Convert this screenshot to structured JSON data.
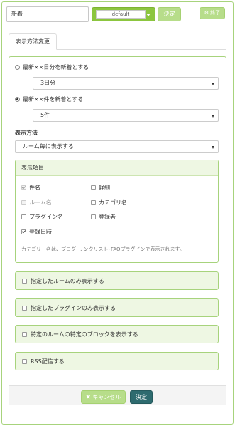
{
  "header": {
    "title_value": "新着",
    "style_select_value": "default",
    "decide_label": "決定",
    "finish_label": "終了"
  },
  "tabs": [
    {
      "label": "表示方法変更"
    }
  ],
  "form": {
    "option_days_label": "最新××日分を新着とする",
    "days_select_value": "3日分",
    "option_count_label": "最新××件を新着とする",
    "count_select_value": "5件",
    "display_method_heading": "表示方法",
    "display_method_value": "ルーム毎に表示する",
    "display_items": {
      "heading": "表示項目",
      "items": [
        {
          "label": "件名",
          "checked": true,
          "disabled": true
        },
        {
          "label": "詳細",
          "checked": false,
          "disabled": false
        },
        {
          "label": "ルーム名",
          "checked": false,
          "disabled": true
        },
        {
          "label": "カテゴリ名",
          "checked": false,
          "disabled": false
        },
        {
          "label": "プラグイン名",
          "checked": false,
          "disabled": false
        },
        {
          "label": "登録者",
          "checked": false,
          "disabled": false
        },
        {
          "label": "登録日時",
          "checked": true,
          "disabled": false
        }
      ],
      "note": "カテゴリー名は、ブログ･リンクリスト･FAQプラグインで表示されます。"
    },
    "options": [
      {
        "label": "指定したルームのみ表示する"
      },
      {
        "label": "指定したプラグインのみ表示する"
      },
      {
        "label": "特定のルームの特定のブロックを表示する"
      },
      {
        "label": "RSS配信する"
      }
    ]
  },
  "footer": {
    "cancel_label": "キャンセル",
    "decide_label": "決定"
  }
}
